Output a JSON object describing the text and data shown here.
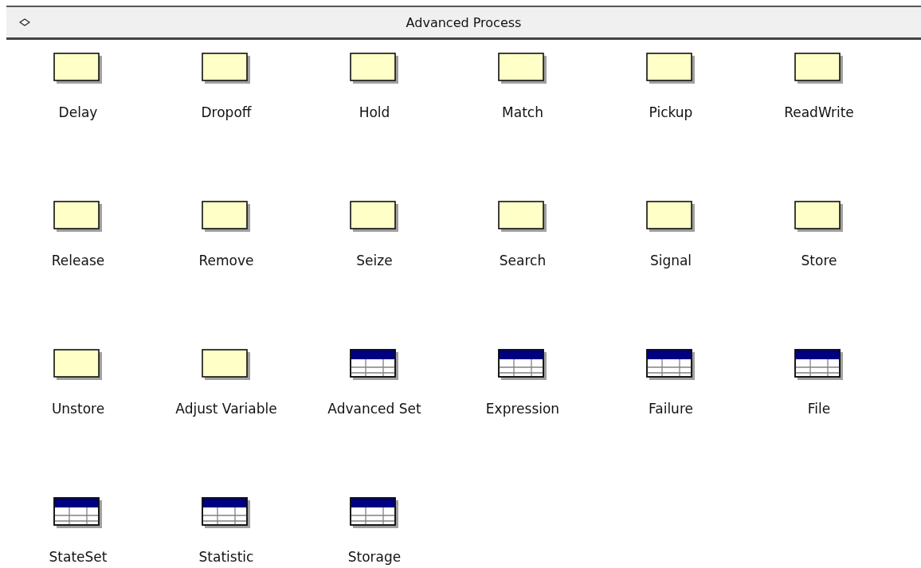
{
  "panel": {
    "title": "Advanced Process",
    "expanded": true
  },
  "items": [
    {
      "label": "Delay",
      "kind": "module"
    },
    {
      "label": "Dropoff",
      "kind": "module"
    },
    {
      "label": "Hold",
      "kind": "module"
    },
    {
      "label": "Match",
      "kind": "module"
    },
    {
      "label": "Pickup",
      "kind": "module"
    },
    {
      "label": "ReadWrite",
      "kind": "module"
    },
    {
      "label": "Release",
      "kind": "module"
    },
    {
      "label": "Remove",
      "kind": "module"
    },
    {
      "label": "Seize",
      "kind": "module"
    },
    {
      "label": "Search",
      "kind": "module"
    },
    {
      "label": "Signal",
      "kind": "module"
    },
    {
      "label": "Store",
      "kind": "module"
    },
    {
      "label": "Unstore",
      "kind": "module"
    },
    {
      "label": "Adjust Variable",
      "kind": "module"
    },
    {
      "label": "Advanced Set",
      "kind": "data"
    },
    {
      "label": "Expression",
      "kind": "data"
    },
    {
      "label": "Failure",
      "kind": "data"
    },
    {
      "label": "File",
      "kind": "data"
    },
    {
      "label": "StateSet",
      "kind": "data"
    },
    {
      "label": "Statistic",
      "kind": "data"
    },
    {
      "label": "Storage",
      "kind": "data"
    }
  ]
}
